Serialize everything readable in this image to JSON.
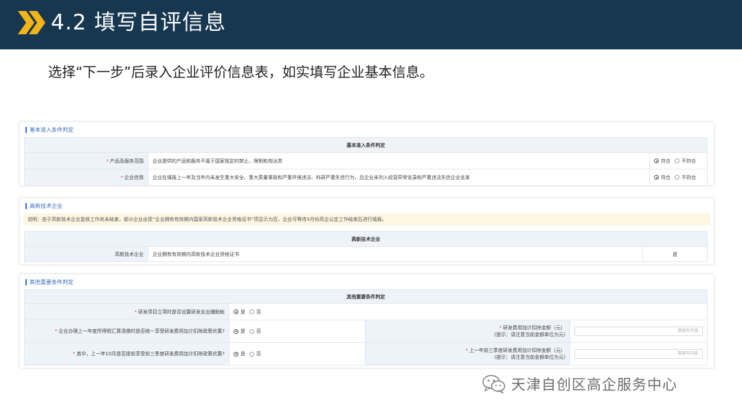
{
  "slide": {
    "title": "4.2 填写自评信息",
    "subtitle": "选择“下一步”后录入企业评价信息表，如实填写企业基本信息。"
  },
  "basic": {
    "section_title": "基本准入条件判定",
    "table_caption": "基本准入条件判定",
    "rows": [
      {
        "label": "产品及服务范围",
        "content": "企业提供的产品和服务不属于国家规定的禁止、限制和淘汰类",
        "yes": "符合",
        "no": "不符合"
      },
      {
        "label": "企业信用",
        "content": "企业在填报上一年及当年内未发生重大安全、重大质量事故和严重环境违法、科研严重失信行为，且企业未列入经营异常名录和严重违法失信企业名单",
        "yes": "符合",
        "no": "不符合"
      }
    ]
  },
  "hightech": {
    "section_title": "高新技术企业",
    "note": "说明：由于高新技术企业复核工作尚未结束，部分企业出现“企业拥有有效期内国家高新技术企业资格证书”项显示为否，企业可等待3月份高企认定工作结束后进行填报。",
    "table_caption": "高新技术企业",
    "row": {
      "label": "高新技术企业",
      "content": "企业拥有有效期内高新技术企业资格证书",
      "value": "是"
    }
  },
  "other": {
    "section_title": "其他重要条件判定",
    "table_caption": "其他重要条件判定",
    "rows": [
      {
        "label": "研发项目立项时是否设置研发支出辅助帐",
        "yes": "是",
        "no": "否"
      },
      {
        "label": "企业办理上一年度所得税汇算清缴时是否统一享受研发费用加计扣除政策优惠?",
        "yes": "是",
        "no": "否",
        "amount_label": "研发费用加计扣除金额（元）",
        "amount_hint": "(提示：请注意当前金额单位为元)",
        "placeholder": "请填写内容"
      },
      {
        "label": "其中，上一年10月是否提前享受前三季度研发费用加计扣除政策优惠?",
        "yes": "是",
        "no": "否",
        "amount_label": "上一年前三季度研发费用加计扣除金额（元）",
        "amount_hint": "(提示：请注意当前金额单位为元)",
        "placeholder": "请填写内容"
      }
    ]
  },
  "watermark": {
    "text": "天津自创区高企服务中心"
  },
  "colors": {
    "header_bg": "#16374f",
    "accent": "#f2b418",
    "link_blue": "#3d6ebf"
  }
}
